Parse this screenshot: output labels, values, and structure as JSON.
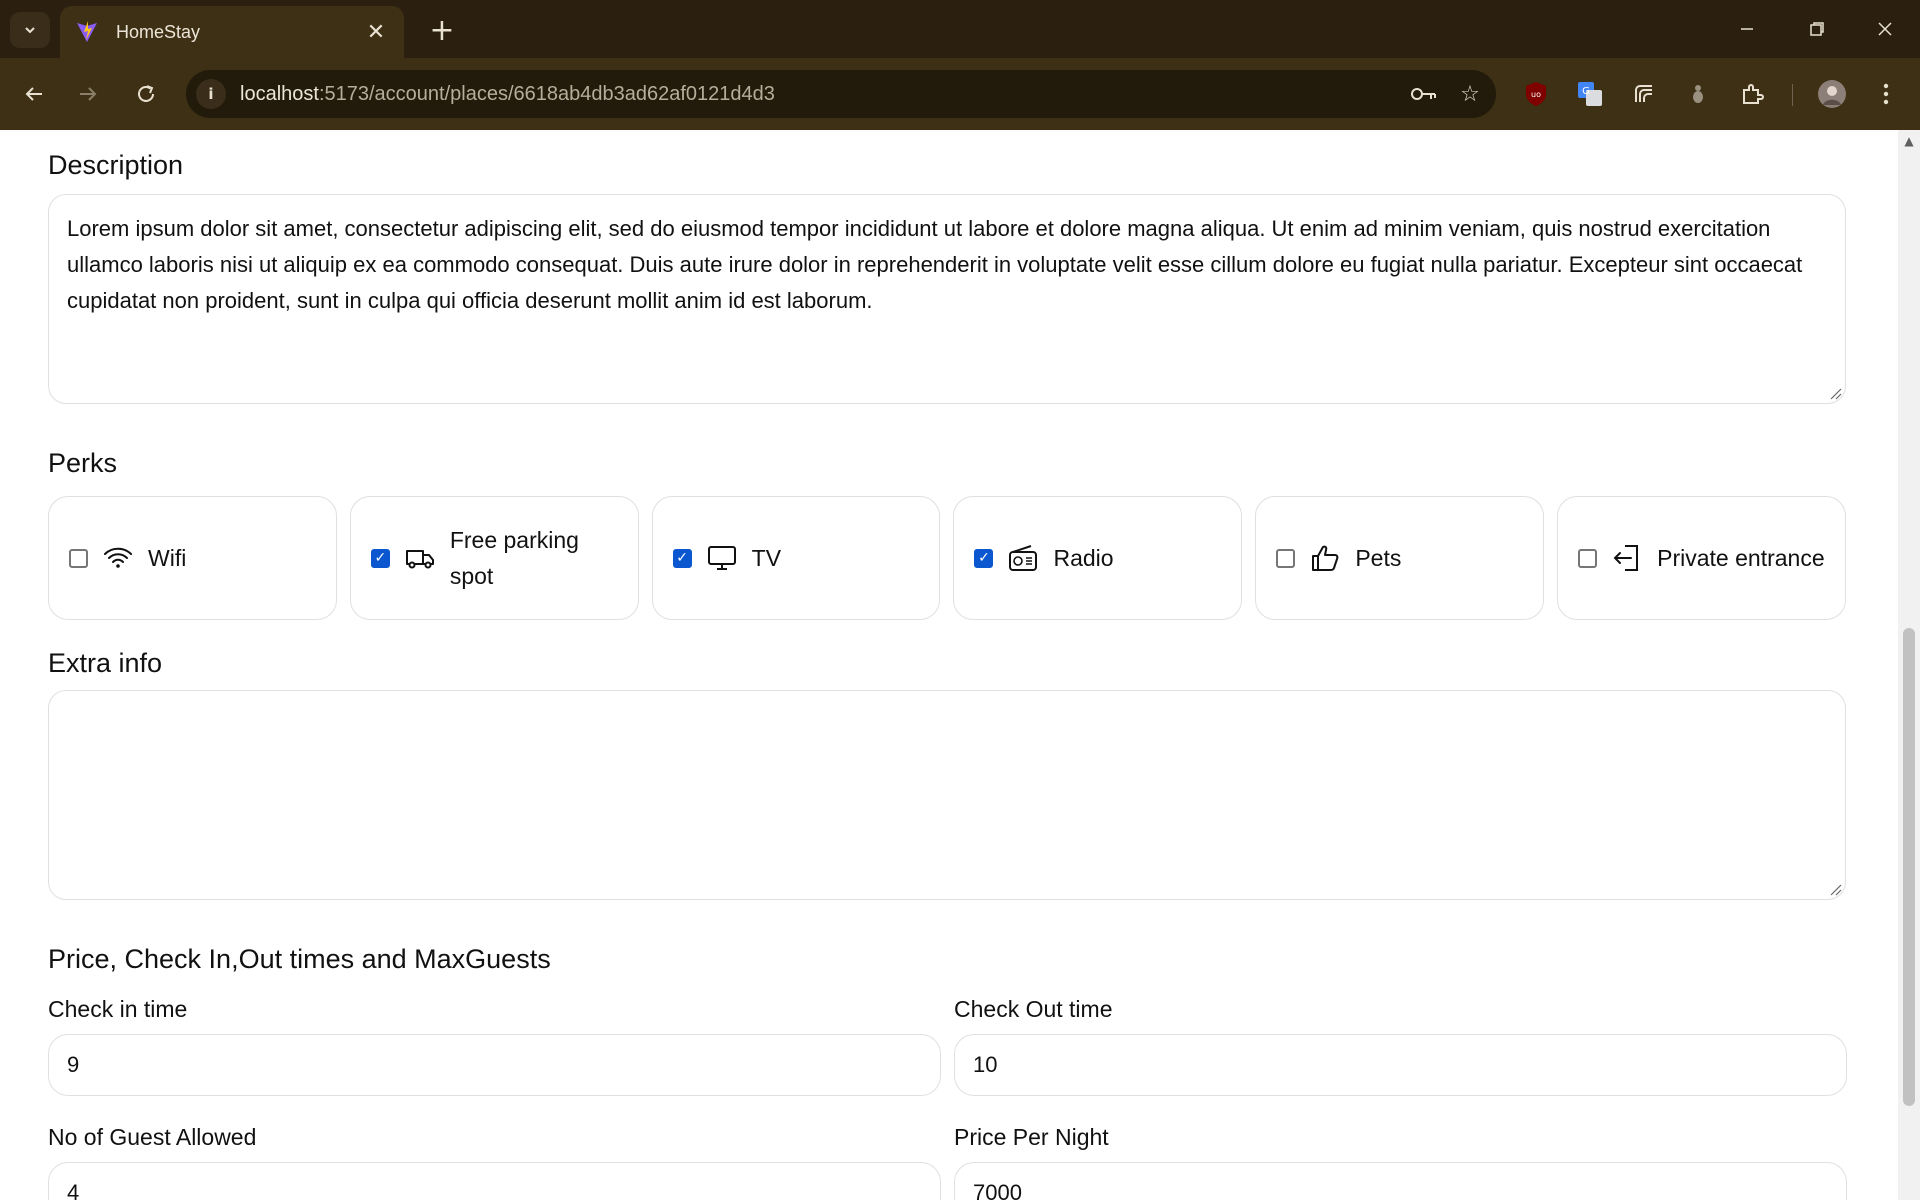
{
  "browser": {
    "tab_title": "HomeStay",
    "url_host": "localhost",
    "url_rest": ":5173/account/places/6618ab4db3ad62af0121d4d3",
    "colors": {
      "chrome": "#3d3014",
      "tabbar": "#2b2010"
    }
  },
  "form": {
    "description": {
      "heading": "Description",
      "value": "Lorem ipsum dolor sit amet, consectetur adipiscing elit, sed do eiusmod tempor incididunt ut labore et dolore magna aliqua. Ut enim ad minim veniam, quis nostrud exercitation ullamco laboris nisi ut aliquip ex ea commodo consequat. Duis aute irure dolor in reprehenderit in voluptate velit esse cillum dolore eu fugiat nulla pariatur. Excepteur sint occaecat cupidatat non proident, sunt in culpa qui officia deserunt mollit anim id est laborum."
    },
    "perks": {
      "heading": "Perks",
      "items": [
        {
          "label": "Wifi",
          "checked": false,
          "icon": "wifi-icon"
        },
        {
          "label": "Free parking spot",
          "checked": true,
          "icon": "truck-icon"
        },
        {
          "label": "TV",
          "checked": true,
          "icon": "tv-icon"
        },
        {
          "label": "Radio",
          "checked": true,
          "icon": "radio-icon"
        },
        {
          "label": "Pets",
          "checked": false,
          "icon": "thumbs-up-icon"
        },
        {
          "label": "Private entrance",
          "checked": false,
          "icon": "entrance-icon"
        }
      ]
    },
    "extra_info": {
      "heading": "Extra info",
      "value": ""
    },
    "pricing": {
      "heading": "Price, Check In,Out times and MaxGuests",
      "check_in_label": "Check in time",
      "check_in_value": "9",
      "check_out_label": "Check Out time",
      "check_out_value": "10",
      "guests_label": "No of Guest Allowed",
      "guests_value": "4",
      "price_label": "Price Per Night",
      "price_value": "7000"
    }
  }
}
